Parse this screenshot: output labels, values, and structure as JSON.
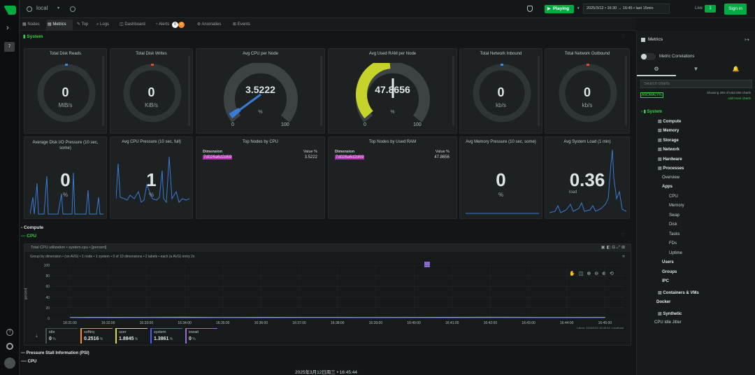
{
  "topbar": {
    "space": "local",
    "play_label": "Playing",
    "time_range": "2025/3/12 • 16:30 → 16:45 • last 15min",
    "live_label": "Live",
    "live_count": "1",
    "signin_label": "Sign in"
  },
  "tabs": [
    {
      "label": "Nodes"
    },
    {
      "label": "Metrics"
    },
    {
      "label": "Top"
    },
    {
      "label": "Logs"
    },
    {
      "label": "Dashboard"
    },
    {
      "label": "Alerts"
    },
    {
      "label": "Anomalies"
    },
    {
      "label": "Events"
    }
  ],
  "alerts_badge": {
    "warn": "0",
    "crit": "0"
  },
  "leftbar": {
    "badge": "7"
  },
  "section": {
    "system": "System",
    "compute": "- Compute",
    "cpu": "--- CPU",
    "psi": "--- Pressure Stall Information (PSI)",
    "psi_cpu": "---- CPU"
  },
  "gauges": [
    {
      "title": "Total Disk Reads",
      "value": "0",
      "unit": "MiB/s"
    },
    {
      "title": "Total Disk Writes",
      "value": "0",
      "unit": "KiB/s"
    },
    {
      "title": "Avg CPU per Node",
      "value": "3.5222",
      "unit": "%",
      "min": "0",
      "max": "100",
      "fill": 0.035
    },
    {
      "title": "Avg Used RAM per Node",
      "value": "47.8656",
      "unit": "%",
      "min": "0",
      "max": "100",
      "fill": 0.4787
    },
    {
      "title": "Total Network Inbound",
      "value": "0",
      "unit": "kb/s"
    },
    {
      "title": "Total Network Outbound",
      "value": "0",
      "unit": "kb/s"
    }
  ],
  "row2": {
    "disk_io": {
      "title": "Average Disk I/O Pressure (10 sec, some)",
      "value": "0",
      "unit": "%"
    },
    "cpu_pressure": {
      "title": "Avg CPU Pressure (10 sec, full)",
      "value": "1",
      "unit": "%"
    },
    "top_cpu": {
      "title": "Top Nodes by CPU",
      "col1": "Dimension",
      "col2": "Value %",
      "node": "7d026a6d2d69",
      "value": "3.5222"
    },
    "top_ram": {
      "title": "Top Nodes by Used RAM",
      "col1": "Dimension",
      "col2": "Value %",
      "node": "7d026a6d2d69",
      "value": "47.8656"
    },
    "mem_pressure": {
      "title": "Avg Memory Pressure (10 sec, some)",
      "value": "0",
      "unit": "%"
    },
    "load": {
      "title": "Avg System Load (1 min)",
      "value": "0.36",
      "unit": "load"
    }
  },
  "cpu_chart": {
    "title": "Total CPU utilization • system.cpu • [percent]",
    "group_by": "Group by dimension • (on AVG) • 1 node • 1 system • 0 of 10 dimensions • 2 labels • each (a AVG) entry 2s",
    "ylabel": "percent",
    "attribution": "Latest: 2025/3/12 16:45:44 • localhost",
    "chart_data": {
      "type": "area",
      "x": [
        "16:31:00",
        "16:32:00",
        "16:33:00",
        "16:34:00",
        "16:35:00",
        "16:36:00",
        "16:37:00",
        "16:38:00",
        "16:39:00",
        "16:40:00",
        "16:41:00",
        "16:42:00",
        "16:43:00",
        "16:44:00",
        "16:45:00"
      ],
      "ylim": [
        0,
        100
      ],
      "yticks": [
        "100",
        "80",
        "60",
        "40",
        "20",
        "0"
      ],
      "series": [
        {
          "name": "user",
          "color": "#c8d52a",
          "values": [
            1.8,
            2.0,
            1.9,
            2.1,
            1.8,
            1.9,
            2.0,
            1.9,
            1.8,
            2.0,
            1.9,
            2.1,
            1.9,
            1.8,
            1.9
          ]
        },
        {
          "name": "system",
          "color": "#5d77ff",
          "values": [
            1.4,
            1.3,
            1.4,
            1.3,
            1.4,
            1.3,
            1.4,
            1.4,
            1.3,
            1.4,
            1.3,
            1.4,
            1.4,
            1.3,
            1.4
          ]
        }
      ]
    },
    "legend": [
      {
        "name": "idle",
        "value": "0",
        "unit": "%",
        "color": "#4a4f52"
      },
      {
        "name": "softirq",
        "value": "0.2516",
        "unit": "%",
        "color": "#ff8a1e"
      },
      {
        "name": "user",
        "value": "1.8845",
        "unit": "%",
        "color": "#d7e02b"
      },
      {
        "name": "system",
        "value": "1.3861",
        "unit": "%",
        "color": "#4b5cff"
      },
      {
        "name": "iowait",
        "value": "0",
        "unit": "%",
        "color": "#9c6bd9"
      }
    ]
  },
  "timestamp": "2025年3月12日周三 • 16:45:44",
  "right": {
    "title": "Metrics",
    "correlations": "Metric Correlations",
    "search_placeholder": "Search charts",
    "anomaly": "ANOMALY%",
    "showing": "Showing 260 of total 260 charts",
    "add_more": "Add more charts",
    "menu": [
      {
        "label": "System",
        "level": 0,
        "active": true
      },
      {
        "label": "Compute",
        "level": 1
      },
      {
        "label": "Memory",
        "level": 1
      },
      {
        "label": "Storage",
        "level": 1
      },
      {
        "label": "Network",
        "level": 1
      },
      {
        "label": "Hardware",
        "level": 1
      },
      {
        "label": "Processes",
        "level": 1
      },
      {
        "label": "Overview",
        "level": 2
      },
      {
        "label": "Apps",
        "level": 2,
        "bold": true
      },
      {
        "label": "CPU",
        "level": 3
      },
      {
        "label": "Memory",
        "level": 3
      },
      {
        "label": "Swap",
        "level": 3
      },
      {
        "label": "Disk",
        "level": 3
      },
      {
        "label": "Tasks",
        "level": 3
      },
      {
        "label": "FDs",
        "level": 3
      },
      {
        "label": "Uptime",
        "level": 3
      },
      {
        "label": "Users",
        "level": 2,
        "bold": true
      },
      {
        "label": "Groups",
        "level": 2,
        "bold": true
      },
      {
        "label": "IPC",
        "level": 2,
        "bold": true
      },
      {
        "label": "Containers & VMs",
        "level": 1
      },
      {
        "label": "Docker",
        "level": 2,
        "bold": true
      },
      {
        "label": "Synthetic",
        "level": 1
      },
      {
        "label": "CPU Idle Jitter",
        "level": 2
      }
    ]
  }
}
